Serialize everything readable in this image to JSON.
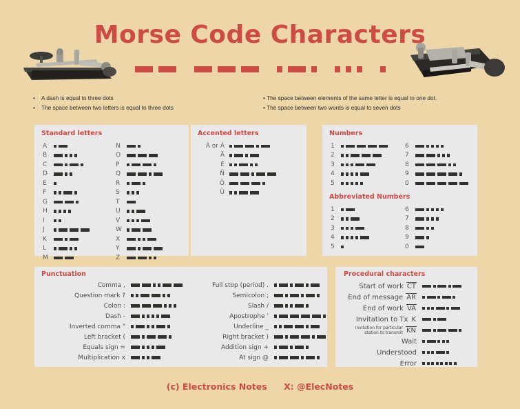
{
  "header": {
    "title": "Morse Code Characters",
    "deco_pattern": [
      [
        "dash",
        "dash"
      ],
      [
        "dash",
        "dash",
        "dash"
      ],
      [
        "dot",
        "dash",
        "dot"
      ],
      [
        "dot",
        "dot",
        "dot"
      ],
      [
        "dot"
      ]
    ]
  },
  "notes": {
    "left": [
      "A dash is equal to three dots",
      "The space between two letters is equal to three dots"
    ],
    "right": [
      "The space between elements of the same letter is equal to one dot.",
      "The space between two words is equal to seven dots"
    ]
  },
  "standard_letters": {
    "title": "Standard letters",
    "col1": [
      {
        "ch": "A",
        "code": ".-"
      },
      {
        "ch": "B",
        "code": "-..."
      },
      {
        "ch": "C",
        "code": "-.-."
      },
      {
        "ch": "D",
        "code": "-.."
      },
      {
        "ch": "E",
        "code": "."
      },
      {
        "ch": "F",
        "code": "..-."
      },
      {
        "ch": "G",
        "code": "--."
      },
      {
        "ch": "H",
        "code": "...."
      },
      {
        "ch": "I",
        "code": ".."
      },
      {
        "ch": "J",
        "code": ".---"
      },
      {
        "ch": "K",
        "code": "-.-"
      },
      {
        "ch": "L",
        "code": ".-.."
      },
      {
        "ch": "M",
        "code": "--"
      }
    ],
    "col2": [
      {
        "ch": "N",
        "code": "-."
      },
      {
        "ch": "O",
        "code": "---"
      },
      {
        "ch": "P",
        "code": ".--."
      },
      {
        "ch": "Q",
        "code": "--.-"
      },
      {
        "ch": "R",
        "code": ".-."
      },
      {
        "ch": "S",
        "code": "..."
      },
      {
        "ch": "T",
        "code": "-"
      },
      {
        "ch": "U",
        "code": "..-"
      },
      {
        "ch": "V",
        "code": "...-"
      },
      {
        "ch": "W",
        "code": ".--"
      },
      {
        "ch": "X",
        "code": "-..-"
      },
      {
        "ch": "Y",
        "code": "-.--"
      },
      {
        "ch": "Z",
        "code": "--.."
      }
    ]
  },
  "accented_letters": {
    "title": "Accented letters",
    "rows": [
      {
        "ch": "À or Á",
        "code": ".--.-"
      },
      {
        "ch": "Ä",
        "code": ".-.-"
      },
      {
        "ch": "É",
        "code": "..-.."
      },
      {
        "ch": "Ñ",
        "code": "--.--"
      },
      {
        "ch": "Ö",
        "code": "---."
      },
      {
        "ch": "Ü",
        "code": "..--"
      }
    ]
  },
  "numbers": {
    "title": "Numbers",
    "col1": [
      {
        "ch": "1",
        "code": ".----"
      },
      {
        "ch": "2",
        "code": "..---"
      },
      {
        "ch": "3",
        "code": "...--"
      },
      {
        "ch": "4",
        "code": "....-"
      },
      {
        "ch": "5",
        "code": "....."
      }
    ],
    "col2": [
      {
        "ch": "6",
        "code": "-...."
      },
      {
        "ch": "7",
        "code": "--..."
      },
      {
        "ch": "8",
        "code": "---.."
      },
      {
        "ch": "9",
        "code": "----."
      },
      {
        "ch": "0",
        "code": "-----"
      }
    ]
  },
  "abbreviated_numbers": {
    "title": "Abbreviated Numbers",
    "col1": [
      {
        "ch": "1",
        "code": ".-"
      },
      {
        "ch": "2",
        "code": "..-"
      },
      {
        "ch": "3",
        "code": "...-"
      },
      {
        "ch": "4",
        "code": "....-"
      },
      {
        "ch": "5",
        "code": "."
      }
    ],
    "col2": [
      {
        "ch": "6",
        "code": "-...."
      },
      {
        "ch": "7",
        "code": "-..."
      },
      {
        "ch": "8",
        "code": "-.."
      },
      {
        "ch": "9",
        "code": "-."
      },
      {
        "ch": "0",
        "code": "-"
      }
    ]
  },
  "punctuation": {
    "title": "Punctuation",
    "col1": [
      {
        "name": "Comma ,",
        "code": "--..--"
      },
      {
        "name": "Question mark ?",
        "code": "..--.."
      },
      {
        "name": "Colon :",
        "code": "---..."
      },
      {
        "name": "Dash -",
        "code": "-....-"
      },
      {
        "name": "Inverted comma \"",
        "code": ".-..-."
      },
      {
        "name": "Left bracket (",
        "code": "-.--."
      },
      {
        "name": "Equals sign =",
        "code": "-...-"
      },
      {
        "name": "Multiplication x",
        "code": "-..-"
      }
    ],
    "col2": [
      {
        "name": "Full stop (period) .",
        "code": ".-.-.-"
      },
      {
        "name": "Semicolon ;",
        "code": "-.-.-."
      },
      {
        "name": "Slash /",
        "code": "-..-."
      },
      {
        "name": "Apostrophe '",
        "code": ".----."
      },
      {
        "name": "Underline _",
        "code": "..--.-"
      },
      {
        "name": "Right bracket )",
        "code": "-.--.-"
      },
      {
        "name": "Addition sign +",
        "code": ".-.-."
      },
      {
        "name": "At sign @",
        "code": ".--.-."
      }
    ]
  },
  "procedural": {
    "title": "Procedural characters",
    "rows": [
      {
        "name": "Start of work",
        "abbr": "CT",
        "overbar": true,
        "code": "-.-.-"
      },
      {
        "name": "End of message",
        "abbr": "AR",
        "overbar": true,
        "code": ".-.-."
      },
      {
        "name": "End of work",
        "abbr": "VA",
        "overbar": true,
        "code": "...-.-"
      },
      {
        "name": "Invitation to Tx",
        "abbr": "K",
        "overbar": false,
        "code": "-.-"
      },
      {
        "name": "Invitation for particular\nstation to transmit",
        "abbr": "KN",
        "overbar": true,
        "code": "-.--.",
        "small": true
      },
      {
        "name": "Wait",
        "abbr": "",
        "overbar": false,
        "code": ".-..."
      },
      {
        "name": "Understood",
        "abbr": "",
        "overbar": false,
        "code": "...-."
      },
      {
        "name": "Error",
        "abbr": "",
        "overbar": false,
        "code": "........"
      }
    ]
  },
  "footer": {
    "copyright": "(c) Electronics Notes",
    "social": "X: @ElecNotes"
  },
  "colors": {
    "background": "#EDD6A8",
    "panel": "#E9E9E9",
    "accent": "#CE4A45",
    "morse": "#33312E",
    "text": "#4A4A4A"
  },
  "images": {
    "left_key": "telegraph-key-icon",
    "right_key": "telegraph-key-icon"
  }
}
